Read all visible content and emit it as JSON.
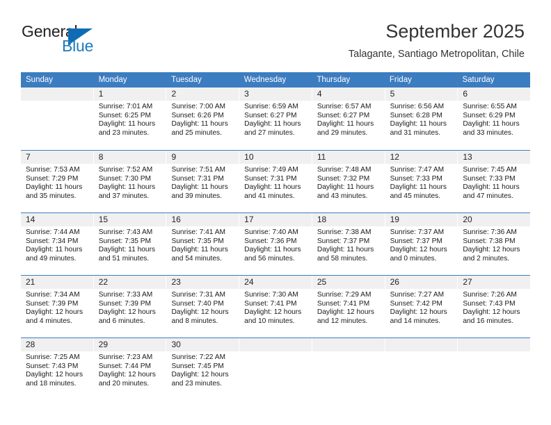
{
  "brand": {
    "name_top": "General",
    "name_bottom": "Blue",
    "triangle_color": "#0f6cb4",
    "blue_color": "#1c7ac0"
  },
  "header": {
    "title": "September 2025",
    "subtitle": "Talagante, Santiago Metropolitan, Chile"
  },
  "theme": {
    "header_band": "#3c7cc0",
    "day_band": "#f0f0f0",
    "grid_line": "#3c7cc0",
    "text": "#1a1a1a"
  },
  "weekdays": [
    "Sunday",
    "Monday",
    "Tuesday",
    "Wednesday",
    "Thursday",
    "Friday",
    "Saturday"
  ],
  "weeks": [
    {
      "days": [
        {
          "day": "",
          "empty": true,
          "sunrise": "",
          "sunset": "",
          "daylight_line1": "",
          "daylight_line2": ""
        },
        {
          "day": "1",
          "empty": false,
          "sunrise": "Sunrise: 7:01 AM",
          "sunset": "Sunset: 6:25 PM",
          "daylight_line1": "Daylight: 11 hours",
          "daylight_line2": "and 23 minutes."
        },
        {
          "day": "2",
          "empty": false,
          "sunrise": "Sunrise: 7:00 AM",
          "sunset": "Sunset: 6:26 PM",
          "daylight_line1": "Daylight: 11 hours",
          "daylight_line2": "and 25 minutes."
        },
        {
          "day": "3",
          "empty": false,
          "sunrise": "Sunrise: 6:59 AM",
          "sunset": "Sunset: 6:27 PM",
          "daylight_line1": "Daylight: 11 hours",
          "daylight_line2": "and 27 minutes."
        },
        {
          "day": "4",
          "empty": false,
          "sunrise": "Sunrise: 6:57 AM",
          "sunset": "Sunset: 6:27 PM",
          "daylight_line1": "Daylight: 11 hours",
          "daylight_line2": "and 29 minutes."
        },
        {
          "day": "5",
          "empty": false,
          "sunrise": "Sunrise: 6:56 AM",
          "sunset": "Sunset: 6:28 PM",
          "daylight_line1": "Daylight: 11 hours",
          "daylight_line2": "and 31 minutes."
        },
        {
          "day": "6",
          "empty": false,
          "sunrise": "Sunrise: 6:55 AM",
          "sunset": "Sunset: 6:29 PM",
          "daylight_line1": "Daylight: 11 hours",
          "daylight_line2": "and 33 minutes."
        }
      ]
    },
    {
      "days": [
        {
          "day": "7",
          "empty": false,
          "sunrise": "Sunrise: 7:53 AM",
          "sunset": "Sunset: 7:29 PM",
          "daylight_line1": "Daylight: 11 hours",
          "daylight_line2": "and 35 minutes."
        },
        {
          "day": "8",
          "empty": false,
          "sunrise": "Sunrise: 7:52 AM",
          "sunset": "Sunset: 7:30 PM",
          "daylight_line1": "Daylight: 11 hours",
          "daylight_line2": "and 37 minutes."
        },
        {
          "day": "9",
          "empty": false,
          "sunrise": "Sunrise: 7:51 AM",
          "sunset": "Sunset: 7:31 PM",
          "daylight_line1": "Daylight: 11 hours",
          "daylight_line2": "and 39 minutes."
        },
        {
          "day": "10",
          "empty": false,
          "sunrise": "Sunrise: 7:49 AM",
          "sunset": "Sunset: 7:31 PM",
          "daylight_line1": "Daylight: 11 hours",
          "daylight_line2": "and 41 minutes."
        },
        {
          "day": "11",
          "empty": false,
          "sunrise": "Sunrise: 7:48 AM",
          "sunset": "Sunset: 7:32 PM",
          "daylight_line1": "Daylight: 11 hours",
          "daylight_line2": "and 43 minutes."
        },
        {
          "day": "12",
          "empty": false,
          "sunrise": "Sunrise: 7:47 AM",
          "sunset": "Sunset: 7:33 PM",
          "daylight_line1": "Daylight: 11 hours",
          "daylight_line2": "and 45 minutes."
        },
        {
          "day": "13",
          "empty": false,
          "sunrise": "Sunrise: 7:45 AM",
          "sunset": "Sunset: 7:33 PM",
          "daylight_line1": "Daylight: 11 hours",
          "daylight_line2": "and 47 minutes."
        }
      ]
    },
    {
      "days": [
        {
          "day": "14",
          "empty": false,
          "sunrise": "Sunrise: 7:44 AM",
          "sunset": "Sunset: 7:34 PM",
          "daylight_line1": "Daylight: 11 hours",
          "daylight_line2": "and 49 minutes."
        },
        {
          "day": "15",
          "empty": false,
          "sunrise": "Sunrise: 7:43 AM",
          "sunset": "Sunset: 7:35 PM",
          "daylight_line1": "Daylight: 11 hours",
          "daylight_line2": "and 51 minutes."
        },
        {
          "day": "16",
          "empty": false,
          "sunrise": "Sunrise: 7:41 AM",
          "sunset": "Sunset: 7:35 PM",
          "daylight_line1": "Daylight: 11 hours",
          "daylight_line2": "and 54 minutes."
        },
        {
          "day": "17",
          "empty": false,
          "sunrise": "Sunrise: 7:40 AM",
          "sunset": "Sunset: 7:36 PM",
          "daylight_line1": "Daylight: 11 hours",
          "daylight_line2": "and 56 minutes."
        },
        {
          "day": "18",
          "empty": false,
          "sunrise": "Sunrise: 7:38 AM",
          "sunset": "Sunset: 7:37 PM",
          "daylight_line1": "Daylight: 11 hours",
          "daylight_line2": "and 58 minutes."
        },
        {
          "day": "19",
          "empty": false,
          "sunrise": "Sunrise: 7:37 AM",
          "sunset": "Sunset: 7:37 PM",
          "daylight_line1": "Daylight: 12 hours",
          "daylight_line2": "and 0 minutes."
        },
        {
          "day": "20",
          "empty": false,
          "sunrise": "Sunrise: 7:36 AM",
          "sunset": "Sunset: 7:38 PM",
          "daylight_line1": "Daylight: 12 hours",
          "daylight_line2": "and 2 minutes."
        }
      ]
    },
    {
      "days": [
        {
          "day": "21",
          "empty": false,
          "sunrise": "Sunrise: 7:34 AM",
          "sunset": "Sunset: 7:39 PM",
          "daylight_line1": "Daylight: 12 hours",
          "daylight_line2": "and 4 minutes."
        },
        {
          "day": "22",
          "empty": false,
          "sunrise": "Sunrise: 7:33 AM",
          "sunset": "Sunset: 7:39 PM",
          "daylight_line1": "Daylight: 12 hours",
          "daylight_line2": "and 6 minutes."
        },
        {
          "day": "23",
          "empty": false,
          "sunrise": "Sunrise: 7:31 AM",
          "sunset": "Sunset: 7:40 PM",
          "daylight_line1": "Daylight: 12 hours",
          "daylight_line2": "and 8 minutes."
        },
        {
          "day": "24",
          "empty": false,
          "sunrise": "Sunrise: 7:30 AM",
          "sunset": "Sunset: 7:41 PM",
          "daylight_line1": "Daylight: 12 hours",
          "daylight_line2": "and 10 minutes."
        },
        {
          "day": "25",
          "empty": false,
          "sunrise": "Sunrise: 7:29 AM",
          "sunset": "Sunset: 7:41 PM",
          "daylight_line1": "Daylight: 12 hours",
          "daylight_line2": "and 12 minutes."
        },
        {
          "day": "26",
          "empty": false,
          "sunrise": "Sunrise: 7:27 AM",
          "sunset": "Sunset: 7:42 PM",
          "daylight_line1": "Daylight: 12 hours",
          "daylight_line2": "and 14 minutes."
        },
        {
          "day": "27",
          "empty": false,
          "sunrise": "Sunrise: 7:26 AM",
          "sunset": "Sunset: 7:43 PM",
          "daylight_line1": "Daylight: 12 hours",
          "daylight_line2": "and 16 minutes."
        }
      ]
    },
    {
      "days": [
        {
          "day": "28",
          "empty": false,
          "sunrise": "Sunrise: 7:25 AM",
          "sunset": "Sunset: 7:43 PM",
          "daylight_line1": "Daylight: 12 hours",
          "daylight_line2": "and 18 minutes."
        },
        {
          "day": "29",
          "empty": false,
          "sunrise": "Sunrise: 7:23 AM",
          "sunset": "Sunset: 7:44 PM",
          "daylight_line1": "Daylight: 12 hours",
          "daylight_line2": "and 20 minutes."
        },
        {
          "day": "30",
          "empty": false,
          "sunrise": "Sunrise: 7:22 AM",
          "sunset": "Sunset: 7:45 PM",
          "daylight_line1": "Daylight: 12 hours",
          "daylight_line2": "and 23 minutes."
        },
        {
          "day": "",
          "empty": true,
          "sunrise": "",
          "sunset": "",
          "daylight_line1": "",
          "daylight_line2": ""
        },
        {
          "day": "",
          "empty": true,
          "sunrise": "",
          "sunset": "",
          "daylight_line1": "",
          "daylight_line2": ""
        },
        {
          "day": "",
          "empty": true,
          "sunrise": "",
          "sunset": "",
          "daylight_line1": "",
          "daylight_line2": ""
        },
        {
          "day": "",
          "empty": true,
          "sunrise": "",
          "sunset": "",
          "daylight_line1": "",
          "daylight_line2": ""
        }
      ]
    }
  ]
}
